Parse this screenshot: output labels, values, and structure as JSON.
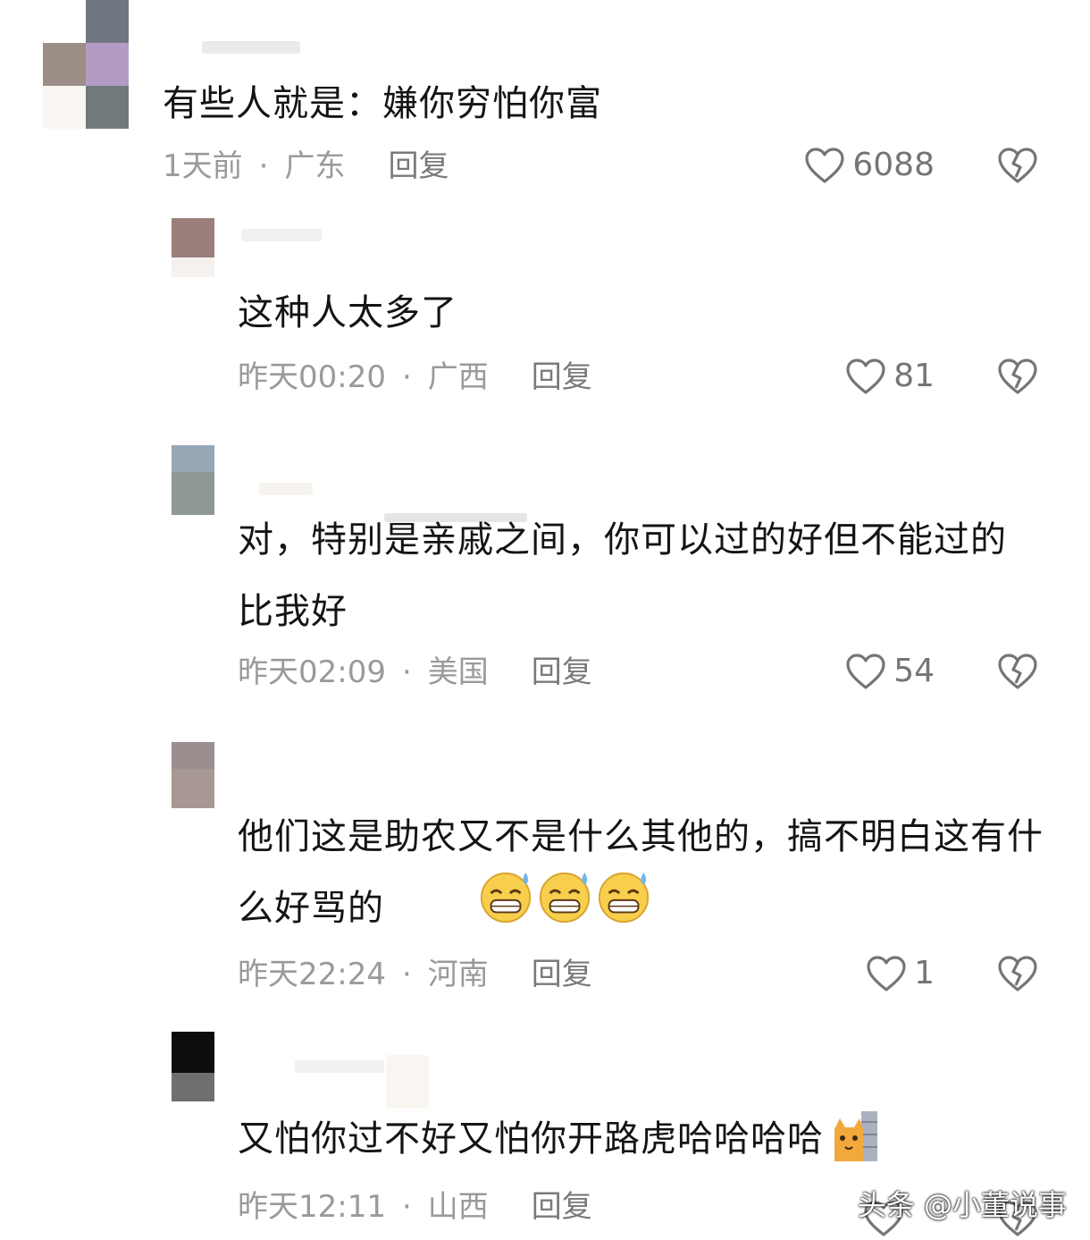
{
  "comments": [
    {
      "text": "有些人就是：嫌你穷怕你富",
      "time": "1天前",
      "dot": "·",
      "location": "广东",
      "reply_label": "回复",
      "likes": "6088"
    },
    {
      "text": "这种人太多了",
      "time": "昨天00:20",
      "dot": "·",
      "location": "广西",
      "reply_label": "回复",
      "likes": "81"
    },
    {
      "text": "对，特别是亲戚之间，你可以过的好但不能过的比我好",
      "time": "昨天02:09",
      "dot": "·",
      "location": "美国",
      "reply_label": "回复",
      "likes": "54"
    },
    {
      "text": "他们这是助农又不是什么其他的，搞不明白这有什么好骂的",
      "time": "昨天22:24",
      "dot": "·",
      "location": "河南",
      "reply_label": "回复",
      "likes": "1"
    },
    {
      "text": "又怕你过不好又怕你开路虎哈哈哈哈",
      "time": "昨天12:11",
      "dot": "·",
      "location": "山西",
      "reply_label": "回复"
    }
  ],
  "watermark": "头条 @小董说事",
  "icons": {
    "like": "heart-outline-icon",
    "dislike": "broken-heart-icon",
    "emoji": "grinning-sweat-emoji",
    "cat": "cat-peeking-emoji"
  },
  "colors": {
    "text": "#141414",
    "meta": "#9a9a9a",
    "icon": "#757575"
  }
}
